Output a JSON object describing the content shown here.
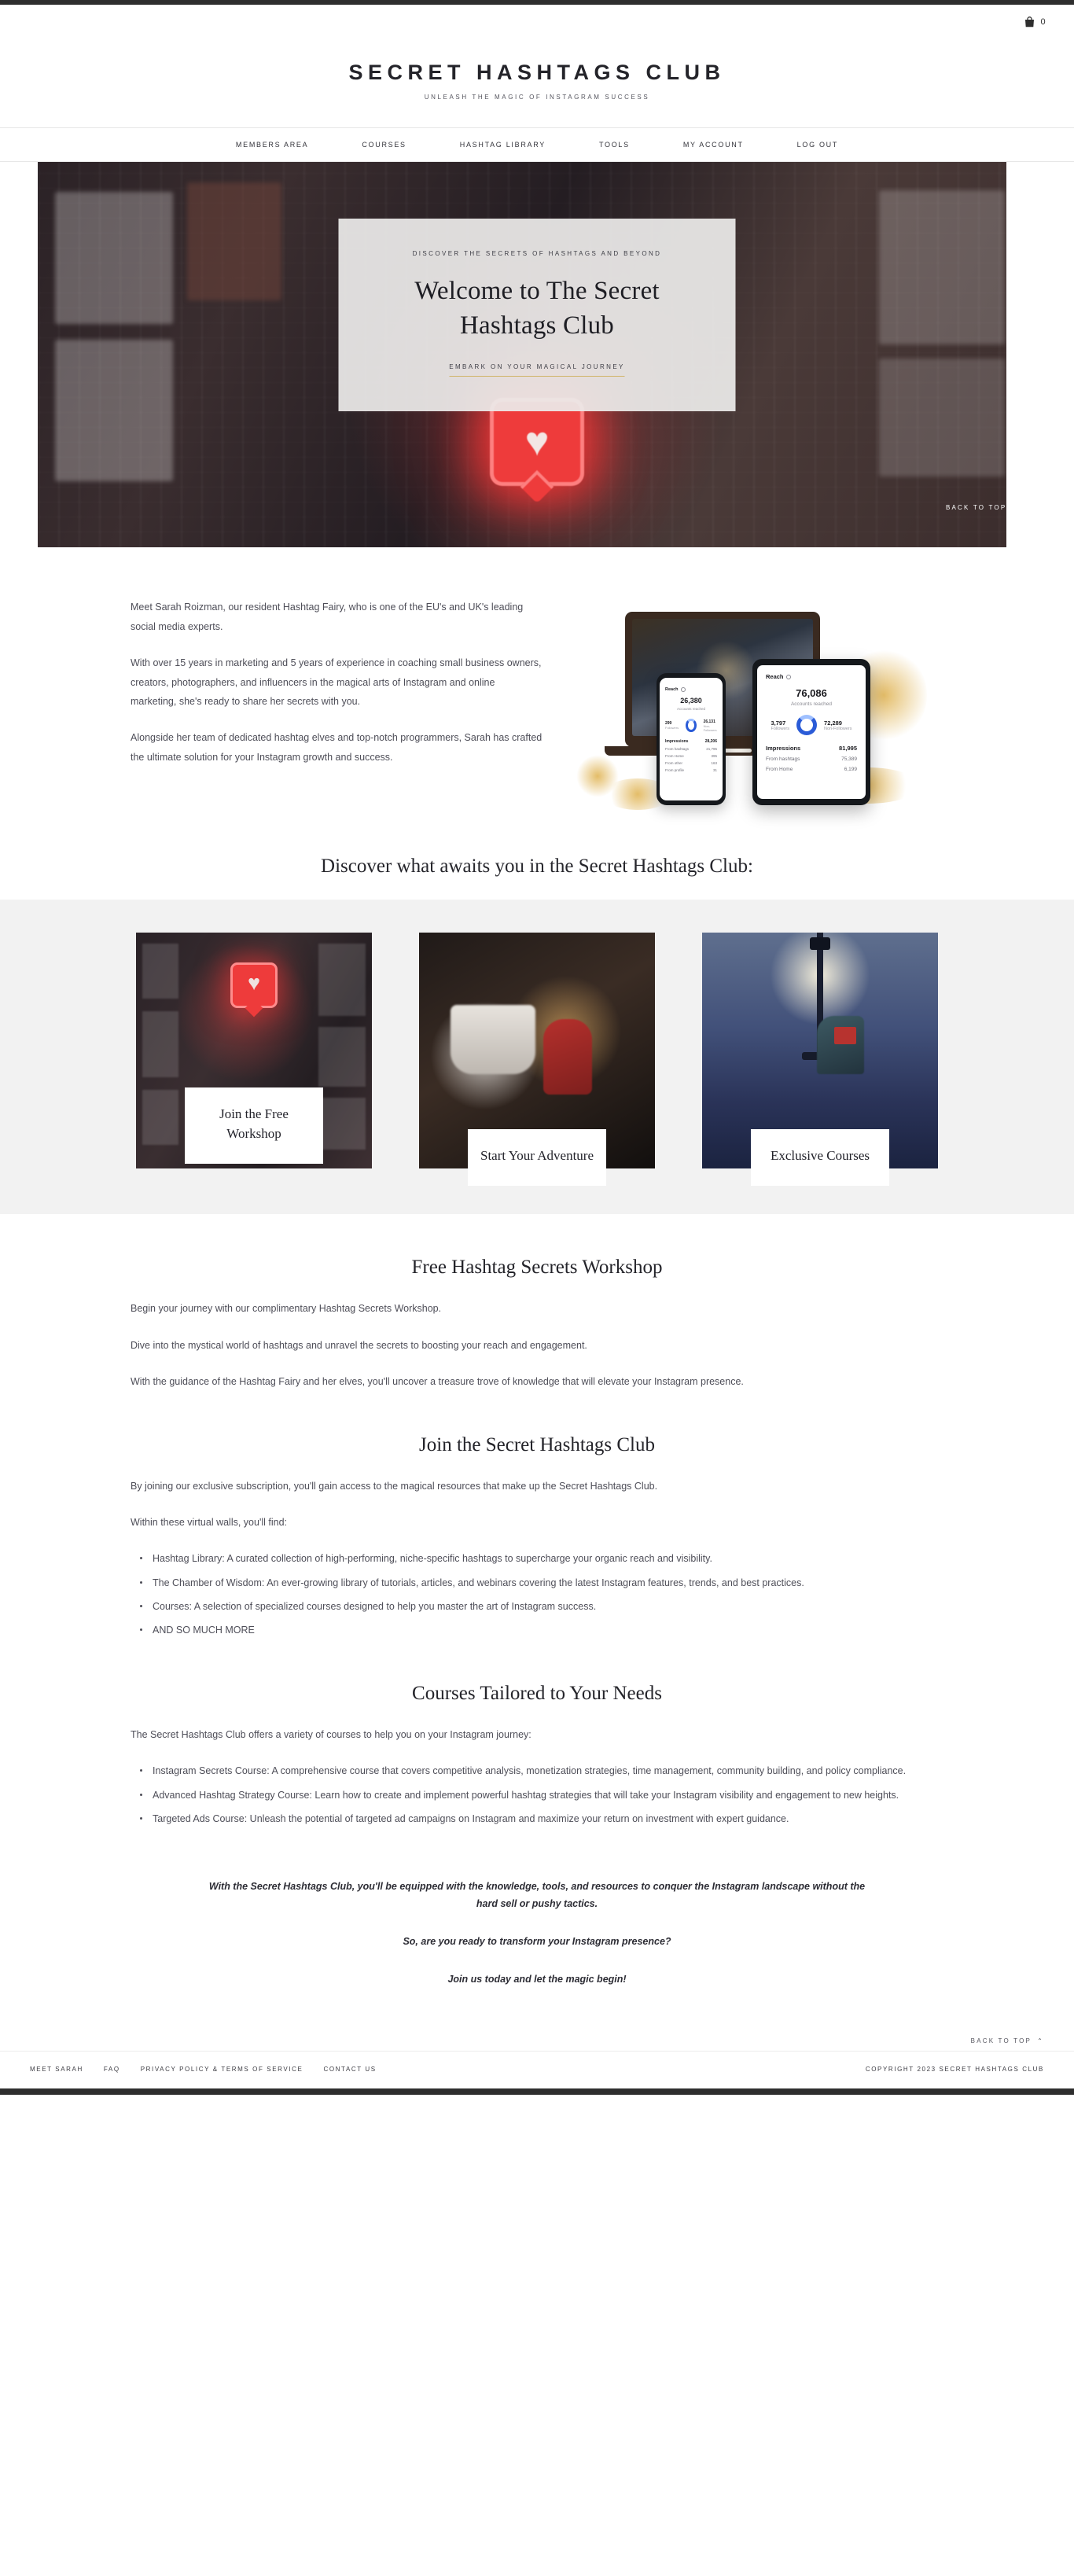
{
  "topbar": {
    "cart_icon": "shopping-bag-icon",
    "cart_count": "0"
  },
  "brand": {
    "title": "SECRET HASHTAGS CLUB",
    "tagline": "UNLEASH THE MAGIC OF INSTAGRAM SUCCESS"
  },
  "nav": {
    "items": [
      {
        "label": "MEMBERS AREA"
      },
      {
        "label": "COURSES"
      },
      {
        "label": "HASHTAG LIBRARY"
      },
      {
        "label": "TOOLS"
      },
      {
        "label": "MY ACCOUNT"
      },
      {
        "label": "LOG OUT"
      }
    ]
  },
  "hero": {
    "eyebrow": "DISCOVER THE SECRETS OF HASHTAGS AND BEYOND",
    "title_line1": "Welcome to The Secret",
    "title_line2": "Hashtags Club",
    "cta": "EMBARK ON YOUR MAGICAL JOURNEY",
    "back_to_top": "BACK TO TOP",
    "back_to_top_caret": "⌃"
  },
  "about": {
    "paragraphs": [
      "Meet Sarah Roizman, our resident Hashtag Fairy, who is one of the EU's and UK's leading social media experts.",
      "With over 15 years in marketing and 5 years of experience in coaching small business owners, creators, photographers, and influencers in the magical arts of Instagram and online marketing, she's ready to share her secrets with you.",
      "Alongside her team of dedicated hashtag elves and top-notch programmers, Sarah has crafted the ultimate solution for your Instagram growth and success."
    ],
    "mockup": {
      "tablet": {
        "title": "Reach",
        "big_number": "76,086",
        "big_label": "Accounts reached",
        "left_number": "3,797",
        "left_label": "Followers",
        "right_number": "72,289",
        "right_label": "Non-Followers",
        "rows": [
          {
            "label": "Impressions",
            "value": "81,995"
          },
          {
            "label": "From hashtags",
            "value": "75,389"
          },
          {
            "label": "From Home",
            "value": "6,199"
          }
        ]
      },
      "phone": {
        "title": "Reach",
        "big_number": "26,380",
        "big_label": "Accounts reached",
        "left_number": "299",
        "left_label": "Followers",
        "right_number": "26,131",
        "right_label": "Non-Followers",
        "rows": [
          {
            "label": "Impressions",
            "value": "28,206"
          },
          {
            "label": "From hashtags",
            "value": "21,795"
          },
          {
            "label": "From Home",
            "value": "395"
          },
          {
            "label": "From other",
            "value": "163"
          },
          {
            "label": "From profile",
            "value": "31"
          }
        ]
      }
    }
  },
  "discover": {
    "heading": "Discover what awaits you in the Secret Hashtags Club:",
    "cards": [
      {
        "label": "Join the Free Workshop",
        "image": "neon-heart-notification-image"
      },
      {
        "label": "Start Your Adventure",
        "image": "candlelit-cup-image"
      },
      {
        "label": "Exclusive Courses",
        "image": "streetlamp-reader-image"
      }
    ]
  },
  "workshop": {
    "title": "Free Hashtag Secrets Workshop",
    "paragraphs": [
      "Begin your journey with our complimentary Hashtag Secrets Workshop.",
      "Dive into the mystical world of hashtags and unravel the secrets to boosting your reach and engagement.",
      "With the guidance of the Hashtag Fairy and her elves, you'll uncover a treasure trove of knowledge that will elevate your Instagram presence."
    ]
  },
  "join": {
    "title": "Join the Secret Hashtags Club",
    "paragraphs": [
      "By joining our exclusive subscription, you'll gain access to the magical resources that make up the Secret Hashtags Club.",
      "Within these virtual walls, you'll find:"
    ],
    "bullets": [
      "Hashtag Library: A curated collection of high-performing, niche-specific hashtags to supercharge your organic reach and visibility.",
      "The Chamber of Wisdom: An ever-growing library of tutorials, articles, and webinars covering the latest Instagram features, trends, and best practices.",
      "Courses: A selection of specialized courses designed to help you master the art of Instagram success.",
      "AND SO MUCH MORE"
    ]
  },
  "courses": {
    "title": "Courses Tailored to Your Needs",
    "intro": "The Secret Hashtags Club offers a variety of courses to help you on your Instagram journey:",
    "bullets": [
      "Instagram Secrets Course: A comprehensive course that covers competitive analysis, monetization strategies, time management, community building, and policy compliance.",
      "Advanced Hashtag Strategy Course: Learn how to create and implement powerful hashtag strategies that will take your Instagram visibility and engagement to new heights.",
      "Targeted Ads Course: Unleash the potential of targeted ad campaigns on Instagram and maximize your return on investment with expert guidance."
    ]
  },
  "closing": {
    "lines": [
      "With the Secret Hashtags Club, you'll be equipped with the knowledge, tools, and resources to conquer the Instagram landscape without the hard sell or pushy tactics.",
      "So, are you ready to transform your Instagram presence?",
      "Join us today and let the magic begin!"
    ]
  },
  "page_back_to_top": {
    "label": "BACK TO TOP",
    "caret": "⌃"
  },
  "footer": {
    "links": [
      {
        "label": "MEET SARAH"
      },
      {
        "label": "FAQ"
      },
      {
        "label": "PRIVACY POLICY & TERMS OF SERVICE"
      },
      {
        "label": "CONTACT US"
      }
    ],
    "copyright": "COPYRIGHT 2023 SECRET HASHTAGS CLUB"
  },
  "colors": {
    "dark": "#2e2e2e",
    "gold": "#d0b469",
    "band": "#f2f2f2",
    "accent_red": "#ee3b3b"
  }
}
